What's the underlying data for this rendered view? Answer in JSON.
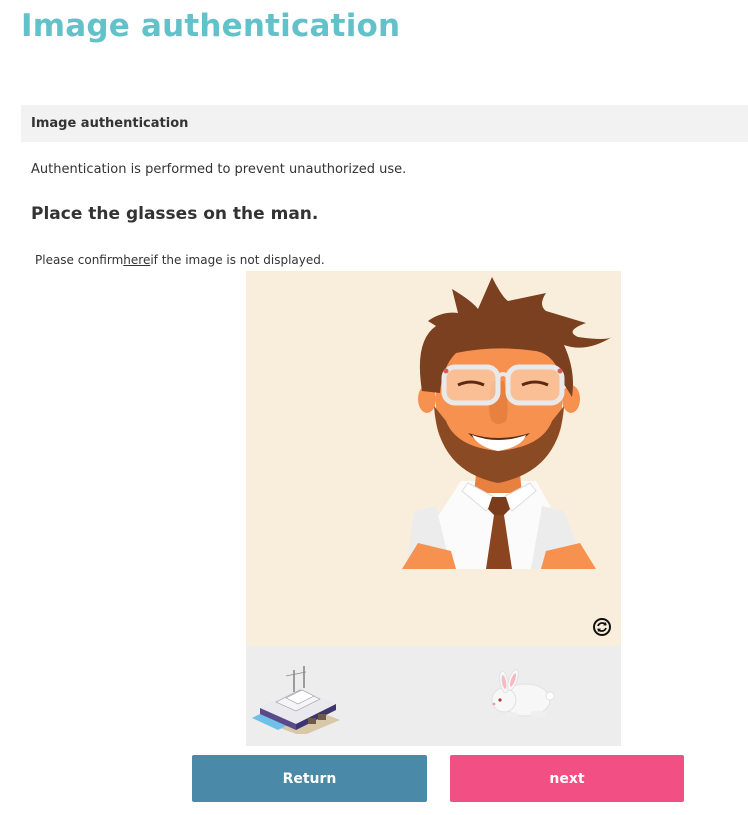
{
  "page": {
    "title": "Image authentication"
  },
  "section": {
    "header": "Image authentication",
    "description": "Authentication is performed to prevent unauthorized use.",
    "instruction": "Place the glasses on the man."
  },
  "confirm": {
    "prefix": "Please confirm",
    "link_text": "here",
    "suffix": "if the image is not displayed."
  },
  "puzzle": {
    "main_image": "man-with-glasses",
    "refresh_icon": "refresh-icon",
    "tray_items": [
      "ship-icon",
      "rabbit-icon"
    ]
  },
  "buttons": {
    "return_label": "Return",
    "next_label": "next"
  },
  "colors": {
    "title": "#63c2c9",
    "return_button": "#4a89a8",
    "next_button": "#f25085",
    "stage_background": "#f9eedc",
    "tray_background": "#ededed"
  }
}
